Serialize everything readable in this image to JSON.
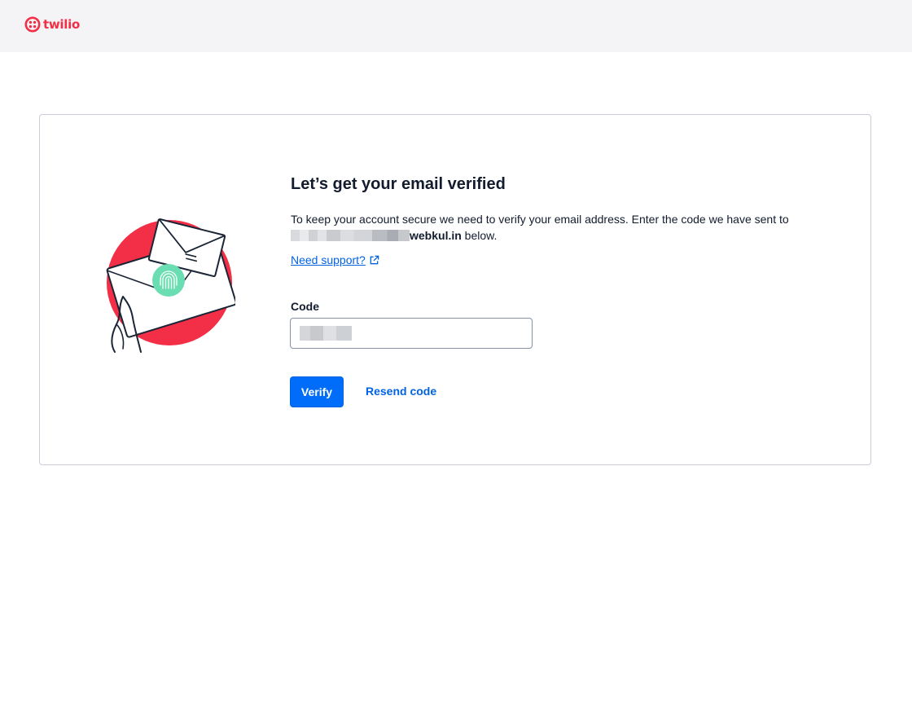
{
  "header": {
    "logo_text": "twilio",
    "brand_color": "#F22F46"
  },
  "verify": {
    "heading": "Let’s get your email verified",
    "description_prefix": "To keep your account secure we need to verify your email address. Enter the code we have sent to",
    "email_domain": "webkul.in",
    "description_suffix": " below.",
    "support_link": "Need support?",
    "code_label": "Code",
    "code_value": "",
    "verify_button": "Verify",
    "resend_button": "Resend code"
  },
  "illustration": {
    "circle_color": "#F22F46",
    "badge_color": "#6ADDB2",
    "icon": "envelope-fingerprint-illustration"
  },
  "colors": {
    "primary": "#006DFA",
    "link": "#0263E0",
    "text": "#121C2D"
  }
}
